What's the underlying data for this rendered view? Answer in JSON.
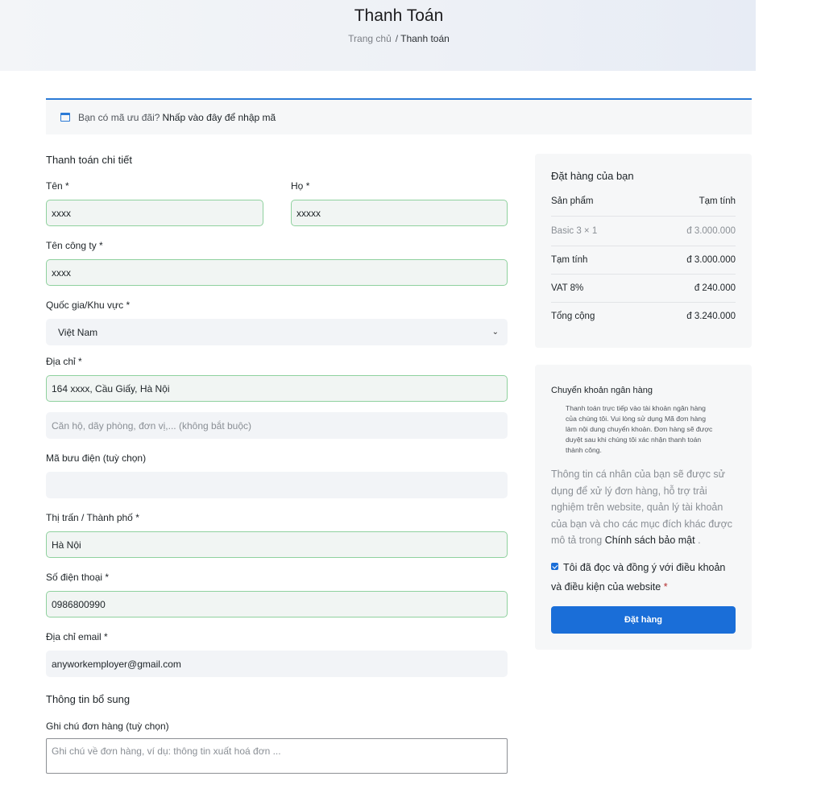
{
  "hero": {
    "title": "Thanh Toán",
    "breadcrumb_home": "Trang chủ",
    "breadcrumb_sep": "/",
    "breadcrumb_current": "Thanh toán"
  },
  "coupon": {
    "question": "Bạn có mã ưu đãi?",
    "link": "Nhấp vào đây để nhập mã",
    "icon": "calendar-icon"
  },
  "billing": {
    "title": "Thanh toán chi tiết",
    "first_name": {
      "label": "Tên",
      "value": "xxxx"
    },
    "last_name": {
      "label": "Họ",
      "value": "xxxxx"
    },
    "company": {
      "label": "Tên công ty",
      "value": "xxxx"
    },
    "country": {
      "label": "Quốc gia/Khu vực",
      "value": "Việt Nam"
    },
    "address": {
      "label": "Địa chỉ",
      "value": "164 xxxx, Cầu Giấy, Hà Nội",
      "placeholder2": "Căn hộ, dãy phòng, đơn vị,... (không bắt buộc)"
    },
    "postcode": {
      "label": "Mã bưu điện (tuỳ chọn)",
      "value": ""
    },
    "city": {
      "label": "Thị trấn / Thành phố",
      "value": "Hà Nội"
    },
    "phone": {
      "label": "Số điện thoại",
      "value": "0986800990"
    },
    "email": {
      "label": "Địa chỉ email",
      "value": "anyworkemployer@gmail.com"
    },
    "required_mark": "*"
  },
  "additional": {
    "title": "Thông tin bổ sung",
    "notes_label": "Ghi chú đơn hàng (tuỳ chọn)",
    "notes_placeholder": "Ghi chú về đơn hàng, ví dụ: thông tin xuất hoá đơn ..."
  },
  "order": {
    "title": "Đặt hàng của bạn",
    "col_product": "Sản phẩm",
    "col_subtotal": "Tạm tính",
    "items": [
      {
        "name": "Basic 3  × 1",
        "price": "đ 3.000.000"
      }
    ],
    "subtotal_label": "Tạm tính",
    "subtotal": "đ 3.000.000",
    "vat_label": "VAT 8%",
    "vat": "đ 240.000",
    "total_label": "Tổng cộng",
    "total": "đ 3.240.000"
  },
  "payment": {
    "method": "Chuyển khoản ngân hàng",
    "description": "Thanh toán trực tiếp vào tài khoản ngân hàng của chúng tôi. Vui lòng sử dụng Mã đơn hàng làm nội dung chuyển khoản. Đơn hàng sẽ được duyệt sau khi chúng tôi xác nhận thanh toán thành công.",
    "privacy_text": "Thông tin cá nhân của bạn sẽ được sử dụng để xử lý đơn hàng, hỗ trợ trải nghiệm trên website, quản lý tài khoản của bạn và cho các mục đích khác được mô tả trong",
    "privacy_link": "Chính sách bảo mật",
    "privacy_end": ".",
    "terms_text": "Tôi đã đọc và đồng ý với điều khoản và điều kiện của website",
    "terms_required": "*",
    "place_order": "Đặt hàng"
  },
  "colors": {
    "accent": "#1a6ed8",
    "valid_border": "#8fd19e"
  }
}
